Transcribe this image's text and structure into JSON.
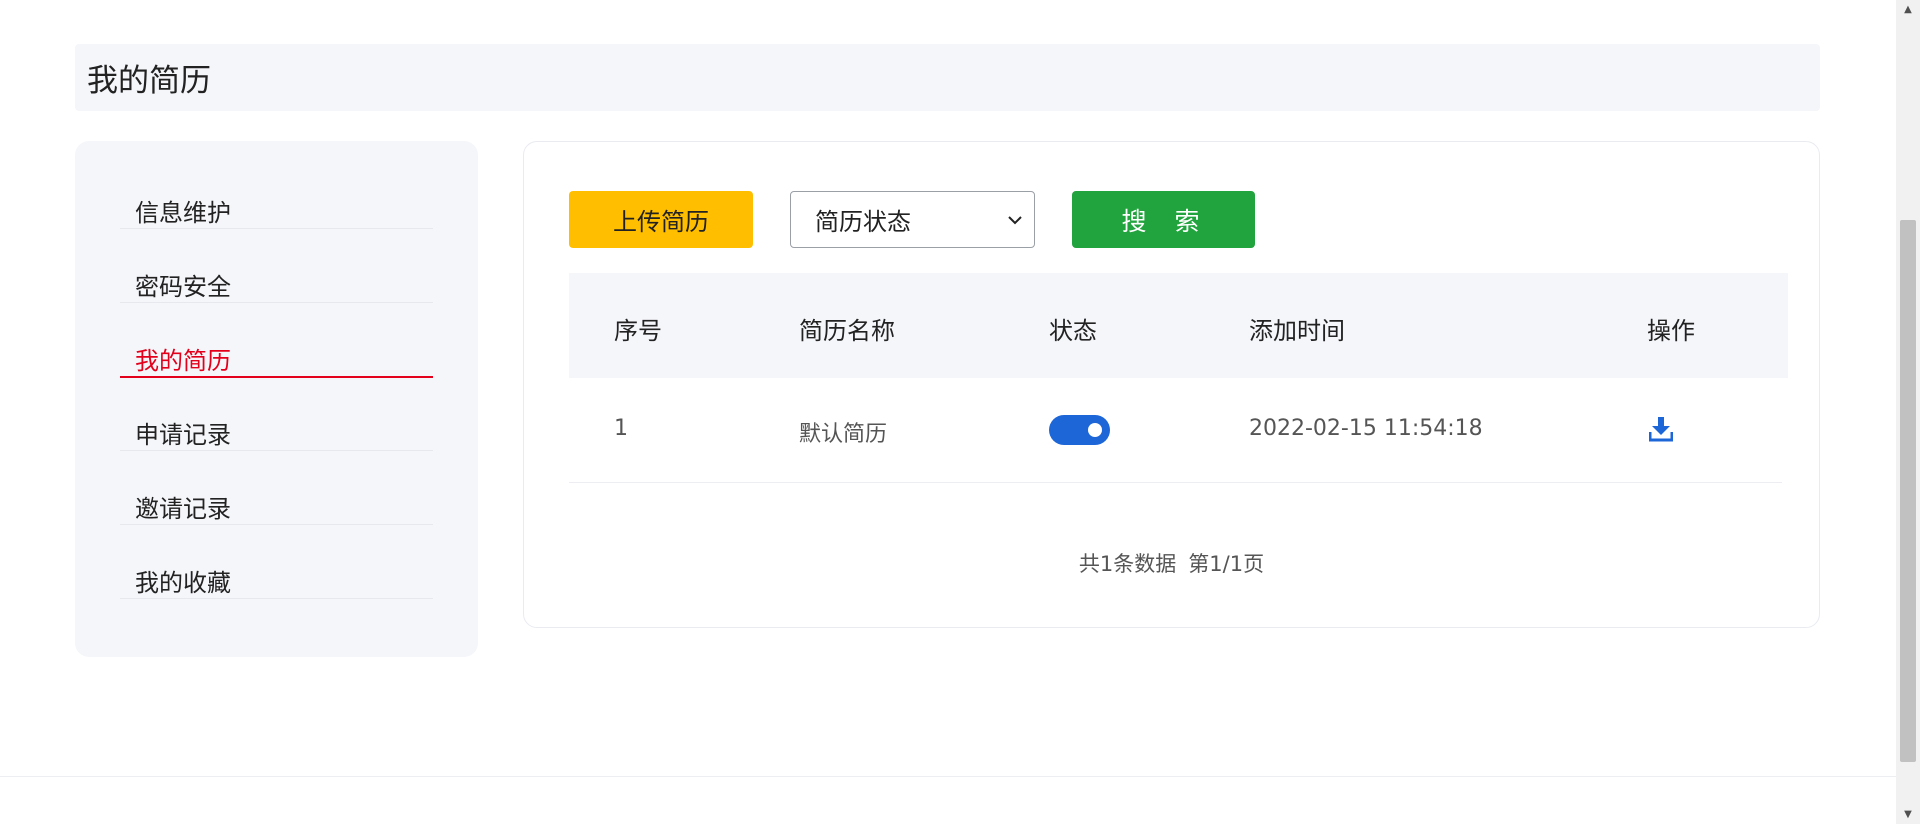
{
  "header": {
    "title": "我的简历"
  },
  "sidebar": {
    "items": [
      {
        "label": "信息维护",
        "active": false
      },
      {
        "label": "密码安全",
        "active": false
      },
      {
        "label": "我的简历",
        "active": true
      },
      {
        "label": "申请记录",
        "active": false
      },
      {
        "label": "邀请记录",
        "active": false
      },
      {
        "label": "我的收藏",
        "active": false
      }
    ]
  },
  "toolbar": {
    "upload_label": "上传简历",
    "status_select": {
      "selected": "简历状态"
    },
    "search_label": "搜 索"
  },
  "table": {
    "headers": [
      "序号",
      "简历名称",
      "状态",
      "添加时间",
      "操作"
    ],
    "rows": [
      {
        "index": "1",
        "name": "默认简历",
        "status_on": true,
        "added_time": "2022-02-15 11:54:18",
        "action_icon": "download-icon"
      }
    ]
  },
  "pagination": {
    "total": "共1条数据",
    "page": "第1/1页"
  },
  "colors": {
    "accent_red": "#e3001b",
    "upload_yellow": "#ffbf00",
    "search_green": "#21a33d",
    "toggle_blue": "#1d66d8",
    "panel_bg": "#f5f6fa"
  }
}
